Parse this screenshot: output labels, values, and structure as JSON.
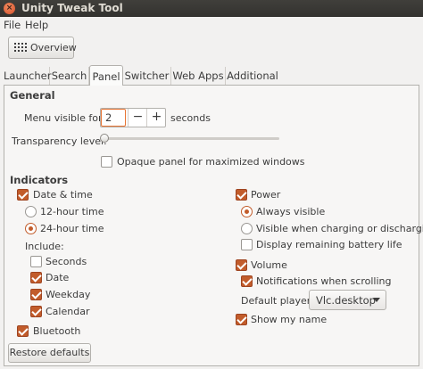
{
  "window": {
    "title": "Unity Tweak Tool",
    "close_glyph": "×"
  },
  "menubar": {
    "items": [
      "File",
      "Help"
    ]
  },
  "toolbar": {
    "overview_label": "Overview"
  },
  "tabs": [
    "Launcher",
    "Search",
    "Panel",
    "Switcher",
    "Web Apps",
    "Additional"
  ],
  "active_tab": "Panel",
  "general": {
    "title": "General",
    "menu_visible_label": "Menu visible for:",
    "menu_visible_value": "2",
    "menu_visible_units": "seconds",
    "spin_minus": "−",
    "spin_plus": "+",
    "transparency_label": "Transparency level:",
    "transparency_value": 0,
    "opaque_label": "Opaque panel for maximized windows",
    "opaque_checked": false
  },
  "indicators": {
    "title": "Indicators",
    "datetime": {
      "label": "Date & time",
      "checked": true,
      "format_12": "12-hour time",
      "format_24": "24-hour time",
      "selected_format": "24-hour time",
      "include_label": "Include:",
      "seconds": "Seconds",
      "date": "Date",
      "weekday": "Weekday",
      "calendar": "Calendar"
    },
    "bluetooth": "Bluetooth",
    "power": {
      "label": "Power",
      "always_visible": "Always visible",
      "visible_charging": "Visible when charging or discharging",
      "battery_life": "Display remaining battery life"
    },
    "volume": {
      "label": "Volume",
      "notifications": "Notifications when scrolling",
      "default_player_label": "Default player:",
      "default_player_value": "Vlc.desktop"
    },
    "show_my_name": "Show my name"
  },
  "footer": {
    "restore_label": "Restore defaults"
  },
  "colors": {
    "accent": "#c25c2b",
    "titlebar": "#3a3935",
    "background": "#f2f1f0"
  }
}
